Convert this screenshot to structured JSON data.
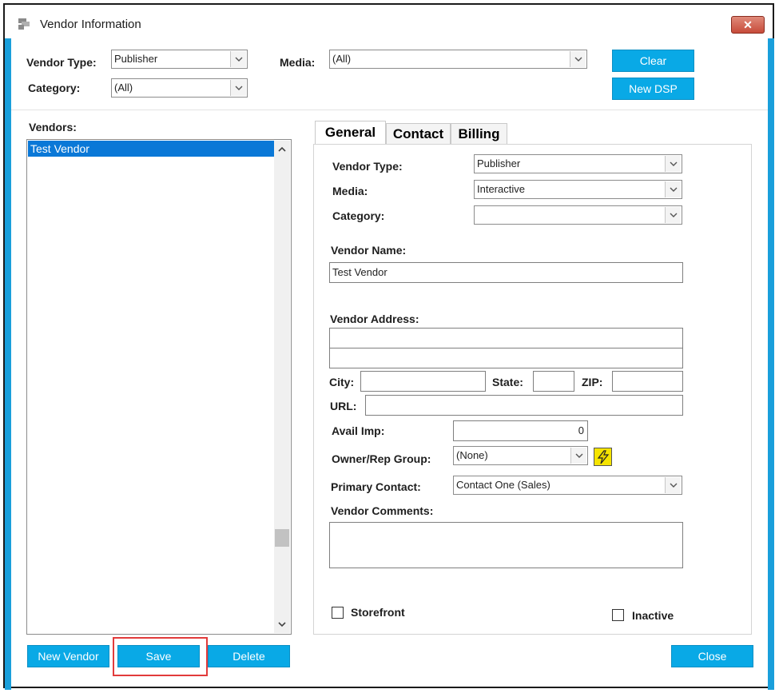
{
  "window": {
    "title": "Vendor Information",
    "close_glyph": "✕"
  },
  "filters": {
    "vendor_type_label": "Vendor Type:",
    "vendor_type_value": "Publisher",
    "category_label": "Category:",
    "category_value": "(All)",
    "media_label": "Media:",
    "media_value": "(All)"
  },
  "top_buttons": {
    "clear": "Clear",
    "new_dsp": "New DSP"
  },
  "vendors": {
    "label": "Vendors:",
    "items": [
      "Test Vendor"
    ],
    "selected_index": 0
  },
  "tabs": [
    "General",
    "Contact",
    "Billing"
  ],
  "general": {
    "vendor_type_label": "Vendor Type:",
    "vendor_type_value": "Publisher",
    "media_label": "Media:",
    "media_value": "Interactive",
    "category_label": "Category:",
    "category_value": "",
    "vendor_name_label": "Vendor Name:",
    "vendor_name_value": "Test Vendor",
    "vendor_address_label": "Vendor Address:",
    "address_line1": "",
    "address_line2": "",
    "city_label": "City:",
    "city_value": "",
    "state_label": "State:",
    "state_value": "",
    "zip_label": "ZIP:",
    "zip_value": "",
    "url_label": "URL:",
    "url_value": "",
    "avail_imp_label": "Avail Imp:",
    "avail_imp_value": "0",
    "owner_label": "Owner/Rep Group:",
    "owner_value": "(None)",
    "primary_contact_label": "Primary Contact:",
    "primary_contact_value": "Contact One (Sales)",
    "comments_label": "Vendor Comments:",
    "comments_value": "",
    "storefront_label": "Storefront",
    "inactive_label": "Inactive"
  },
  "bottom_buttons": {
    "new_vendor": "New Vendor",
    "save": "Save",
    "delete": "Delete",
    "close": "Close"
  },
  "colors": {
    "accent": "#09a9e6",
    "selection": "#0a78d7",
    "highlight_box": "#e23b3b",
    "lightning": "#f5e400"
  }
}
